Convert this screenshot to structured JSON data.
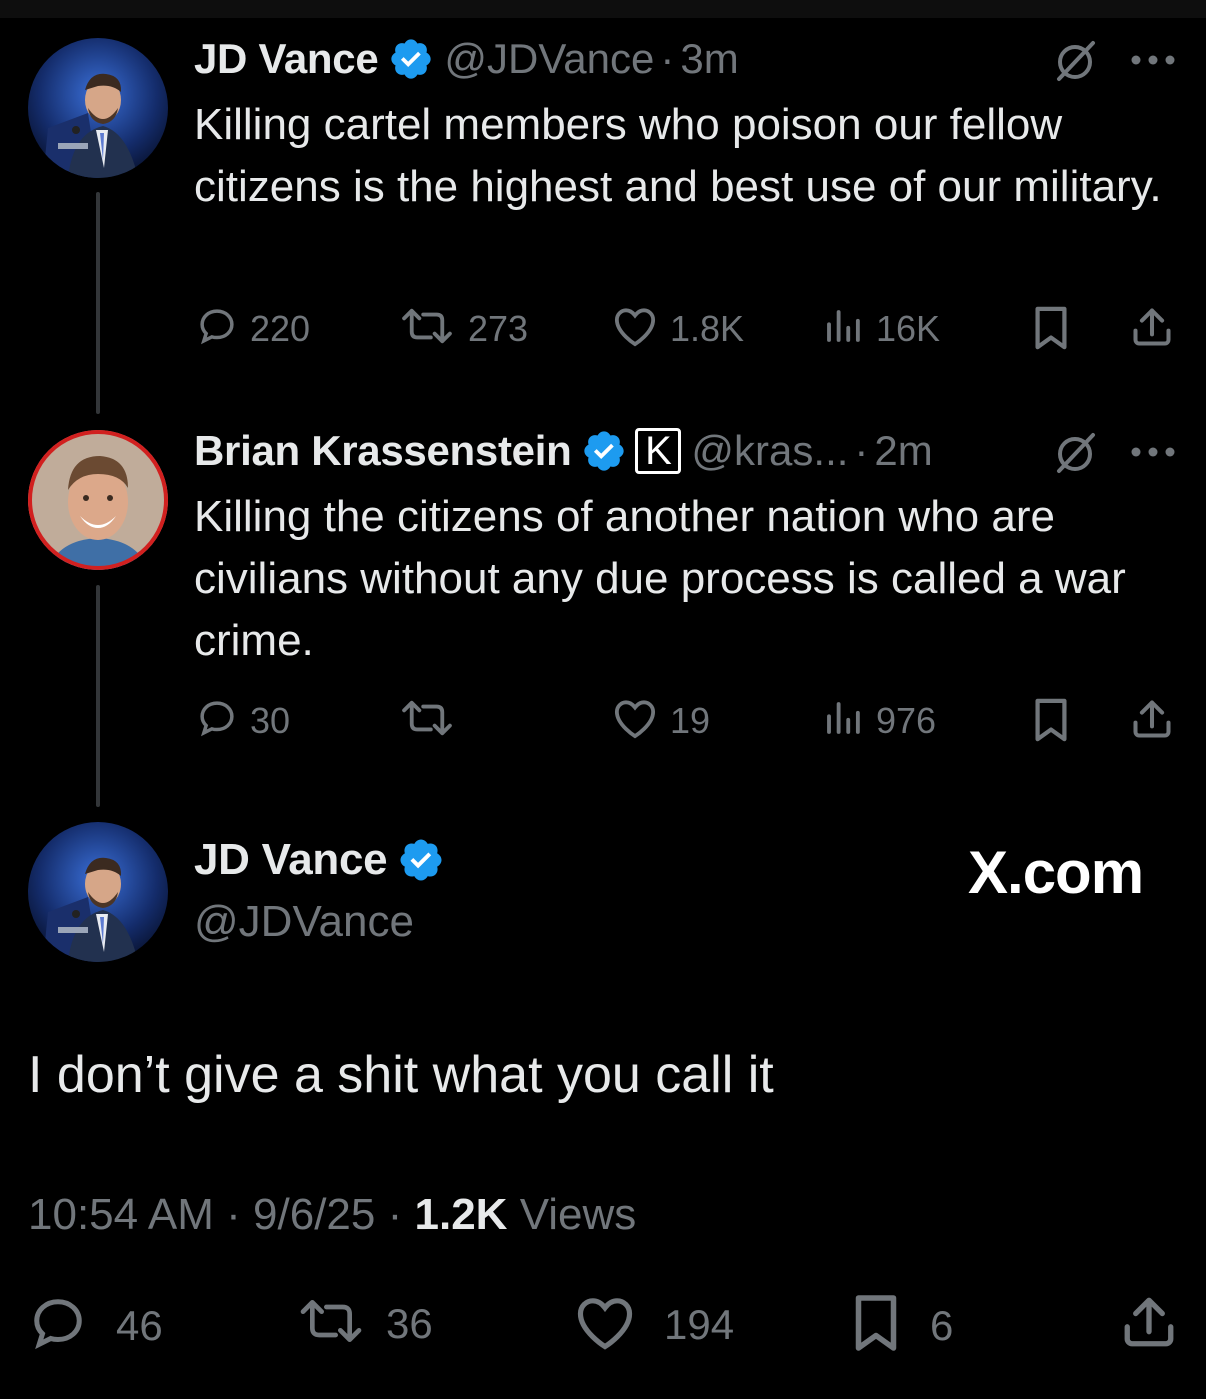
{
  "tweet1": {
    "name": "JD Vance",
    "handle": "@JDVance",
    "separator": "·",
    "time": "3m",
    "text": "Killing cartel members who poison our fellow citizens is the highest and best use of our military.",
    "replies": "220",
    "reposts": "273",
    "likes": "1.8K",
    "views": "16K"
  },
  "tweet2": {
    "name": "Brian Krassenstein",
    "badge_letter": "K",
    "handle": "@kras...",
    "separator": "·",
    "time": "2m",
    "text": "Killing the citizens of another nation who are civilians without any due process is called a war crime.",
    "replies": "30",
    "reposts": "",
    "likes": "19",
    "views": "976"
  },
  "main_tweet": {
    "name": "JD Vance",
    "handle": "@JDVance",
    "watermark": "X.com",
    "text": "I don’t give a shit what you call it",
    "time": "10:54 AM",
    "sep": "·",
    "date": "9/6/25",
    "views_count": "1.2K",
    "views_label": "Views",
    "replies": "46",
    "reposts": "36",
    "likes": "194",
    "bookmarks": "6"
  },
  "colors": {
    "background": "#000000",
    "text_primary": "#e7e9ea",
    "text_secondary": "#71767b",
    "verified": "#1d9bf0",
    "thread_line": "#333639"
  },
  "icons": [
    "verified-badge-icon",
    "grok-icon",
    "more-icon",
    "reply-icon",
    "repost-icon",
    "like-icon",
    "views-icon",
    "bookmark-icon",
    "share-icon"
  ]
}
